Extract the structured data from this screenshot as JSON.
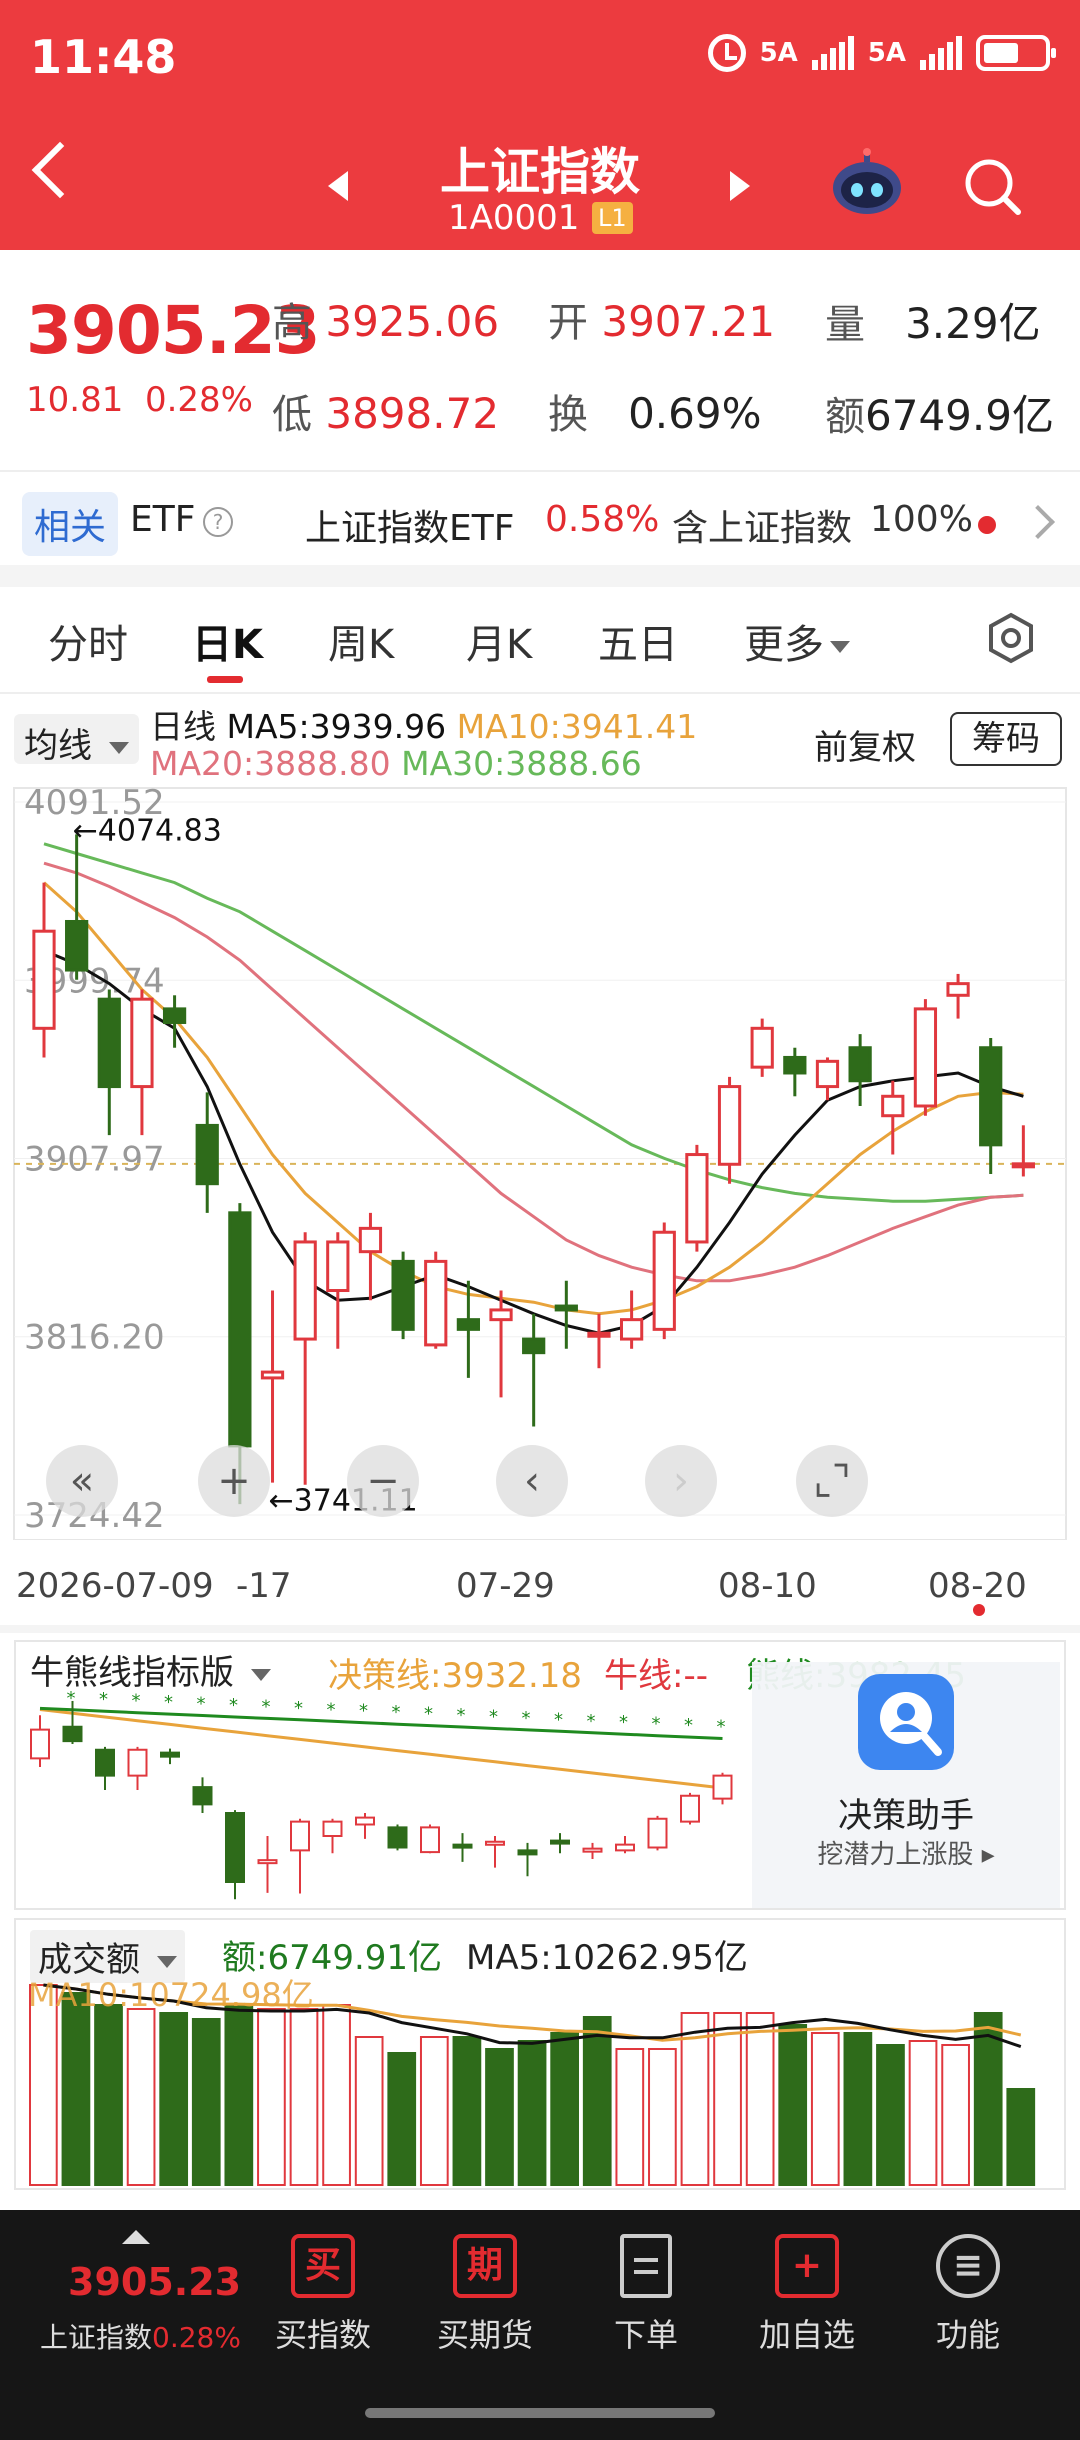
{
  "status_bar": {
    "time": "11:48",
    "net1": "5A",
    "net2": "5A"
  },
  "header": {
    "title": "上证指数",
    "code": "1A0001",
    "level": "L1"
  },
  "quote": {
    "price": "3905.23",
    "change": "10.81",
    "change_pct": "0.28%",
    "high_label": "高",
    "high": "3925.06",
    "open_label": "开",
    "open": "3907.21",
    "vol_label": "量",
    "vol": "3.29亿",
    "low_label": "低",
    "low": "3898.72",
    "turnover_label": "换",
    "turnover": "0.69%",
    "amount_label": "额",
    "amount": "6749.9亿"
  },
  "related": {
    "tag": "相关",
    "etf": "ETF",
    "help": "?",
    "etf_name": "上证指数ETF",
    "etf_pct": "0.58%",
    "contains_label": "含上证指数",
    "contains_pct": "100%"
  },
  "tabs": [
    "分时",
    "日K",
    "周K",
    "月K",
    "五日",
    "更多"
  ],
  "active_tab": "日K",
  "chart_header": {
    "indicator": "均线",
    "line1": {
      "prefix": "日线",
      "ma5": "MA5:3939.96",
      "ma10": "MA10:3941.41"
    },
    "line2": {
      "ma20": "MA20:3888.80",
      "ma30": "MA30:3888.66"
    },
    "adjust": "前复权",
    "chips": "筹码"
  },
  "colors": {
    "up": "#e0383e",
    "down": "#2e6b1a",
    "ma5": "#111111",
    "ma10": "#e8a33b",
    "ma20": "#e0727d",
    "ma30": "#67b95a"
  },
  "chart_data": {
    "type": "candlestick",
    "y_ticks": [
      "4091.52",
      "3999.74",
      "3907.97",
      "3816.20",
      "3724.42"
    ],
    "ylim": [
      3724.42,
      4091.52
    ],
    "annotations": {
      "high": "←4074.83",
      "low": "←3741.11"
    },
    "x_labels": [
      "2026-07-09",
      "-17",
      "07-29",
      "08-10",
      "08-20"
    ],
    "candles": [
      {
        "o": 3975,
        "h": 4050,
        "l": 3960,
        "c": 4025
      },
      {
        "o": 4030,
        "h": 4074.83,
        "l": 4000,
        "c": 4005
      },
      {
        "o": 3990,
        "h": 3995,
        "l": 3920,
        "c": 3945
      },
      {
        "o": 3945,
        "h": 3995,
        "l": 3920,
        "c": 3990
      },
      {
        "o": 3985,
        "h": 3992,
        "l": 3965,
        "c": 3978
      },
      {
        "o": 3925,
        "h": 3942,
        "l": 3880,
        "c": 3895
      },
      {
        "o": 3880,
        "h": 3885,
        "l": 3730,
        "c": 3760
      },
      {
        "o": 3795,
        "h": 3840,
        "l": 3741.11,
        "c": 3798
      },
      {
        "o": 3815,
        "h": 3870,
        "l": 3740,
        "c": 3865
      },
      {
        "o": 3840,
        "h": 3870,
        "l": 3810,
        "c": 3865
      },
      {
        "o": 3860,
        "h": 3880,
        "l": 3835,
        "c": 3872
      },
      {
        "o": 3855,
        "h": 3860,
        "l": 3815,
        "c": 3820
      },
      {
        "o": 3812,
        "h": 3860,
        "l": 3810,
        "c": 3855
      },
      {
        "o": 3825,
        "h": 3845,
        "l": 3795,
        "c": 3820
      },
      {
        "o": 3825,
        "h": 3840,
        "l": 3785,
        "c": 3830
      },
      {
        "o": 3815,
        "h": 3828,
        "l": 3770,
        "c": 3808
      },
      {
        "o": 3832,
        "h": 3845,
        "l": 3810,
        "c": 3830
      },
      {
        "o": 3818,
        "h": 3828,
        "l": 3800,
        "c": 3818
      },
      {
        "o": 3815,
        "h": 3840,
        "l": 3810,
        "c": 3825
      },
      {
        "o": 3820,
        "h": 3875,
        "l": 3815,
        "c": 3870
      },
      {
        "o": 3865,
        "h": 3915,
        "l": 3860,
        "c": 3910
      },
      {
        "o": 3905,
        "h": 3950,
        "l": 3895,
        "c": 3945
      },
      {
        "o": 3955,
        "h": 3980,
        "l": 3950,
        "c": 3975
      },
      {
        "o": 3960,
        "h": 3965,
        "l": 3940,
        "c": 3952
      },
      {
        "o": 3945,
        "h": 3960,
        "l": 3938,
        "c": 3958
      },
      {
        "o": 3965,
        "h": 3972,
        "l": 3935,
        "c": 3948
      },
      {
        "o": 3930,
        "h": 3948,
        "l": 3910,
        "c": 3940
      },
      {
        "o": 3935,
        "h": 3990,
        "l": 3930,
        "c": 3985
      },
      {
        "o": 3992,
        "h": 4003,
        "l": 3980,
        "c": 3998
      },
      {
        "o": 3965,
        "h": 3970,
        "l": 3900,
        "c": 3915
      },
      {
        "o": 3905,
        "h": 3925.06,
        "l": 3898.72,
        "c": 3905.23
      }
    ],
    "ma5": [
      4015,
      4008,
      3998,
      3985,
      3975,
      3945,
      3905,
      3870,
      3845,
      3835,
      3836,
      3842,
      3848,
      3842,
      3835,
      3828,
      3822,
      3818,
      3822,
      3832,
      3852,
      3875,
      3900,
      3920,
      3938,
      3945,
      3948,
      3950,
      3952,
      3945,
      3940
    ],
    "ma10": [
      4050,
      4035,
      4015,
      3995,
      3980,
      3960,
      3935,
      3910,
      3890,
      3875,
      3860,
      3850,
      3842,
      3838,
      3836,
      3834,
      3830,
      3828,
      3830,
      3835,
      3842,
      3852,
      3865,
      3880,
      3895,
      3910,
      3922,
      3932,
      3940,
      3942,
      3941
    ],
    "ma20": [
      4060,
      4055,
      4048,
      4040,
      4032,
      4022,
      4010,
      3995,
      3980,
      3965,
      3950,
      3935,
      3920,
      3905,
      3890,
      3878,
      3866,
      3858,
      3852,
      3848,
      3845,
      3845,
      3848,
      3852,
      3858,
      3865,
      3872,
      3878,
      3884,
      3888,
      3889
    ],
    "ma30": [
      4070,
      4065,
      4060,
      4055,
      4050,
      4042,
      4035,
      4025,
      4015,
      4005,
      3995,
      3985,
      3975,
      3965,
      3955,
      3945,
      3935,
      3925,
      3915,
      3908,
      3902,
      3897,
      3893,
      3890,
      3888,
      3887,
      3886,
      3886,
      3887,
      3888,
      3889
    ]
  },
  "controls": [
    "«",
    "+",
    "−",
    "‹",
    "›",
    "⌞⌝"
  ],
  "bullbear": {
    "name": "牛熊线指标版",
    "decision": "决策线:3932.18",
    "bull": "牛线:--",
    "bear": "熊线:3982.45",
    "assistant_title": "决策助手",
    "assistant_sub": "挖潜力上涨股"
  },
  "volume": {
    "name": "成交额",
    "amount": "额:6749.91亿",
    "ma5": "MA5:10262.95亿",
    "ma10": "MA10:10724.98亿",
    "bars": [
      1.0,
      0.96,
      0.9,
      0.88,
      0.86,
      0.83,
      0.9,
      0.88,
      0.88,
      0.9,
      0.74,
      0.66,
      0.74,
      0.74,
      0.68,
      0.72,
      0.76,
      0.84,
      0.68,
      0.68,
      0.86,
      0.86,
      0.86,
      0.8,
      0.76,
      0.76,
      0.7,
      0.72,
      0.7,
      0.86,
      0.48
    ],
    "up": [
      true,
      false,
      false,
      true,
      false,
      false,
      false,
      true,
      true,
      true,
      true,
      false,
      true,
      false,
      false,
      false,
      false,
      false,
      true,
      true,
      true,
      true,
      true,
      false,
      true,
      false,
      false,
      true,
      true,
      false,
      false
    ]
  },
  "bottom_nav": {
    "price": "3905.23",
    "sub_name": "上证指数",
    "sub_pct": "0.28%",
    "items": [
      {
        "icon": "买",
        "label": "买指数"
      },
      {
        "icon": "期",
        "label": "买期货"
      },
      {
        "icon": "",
        "label": "下单"
      },
      {
        "icon": "+",
        "label": "加自选"
      },
      {
        "icon": "≡",
        "label": "功能"
      }
    ]
  }
}
